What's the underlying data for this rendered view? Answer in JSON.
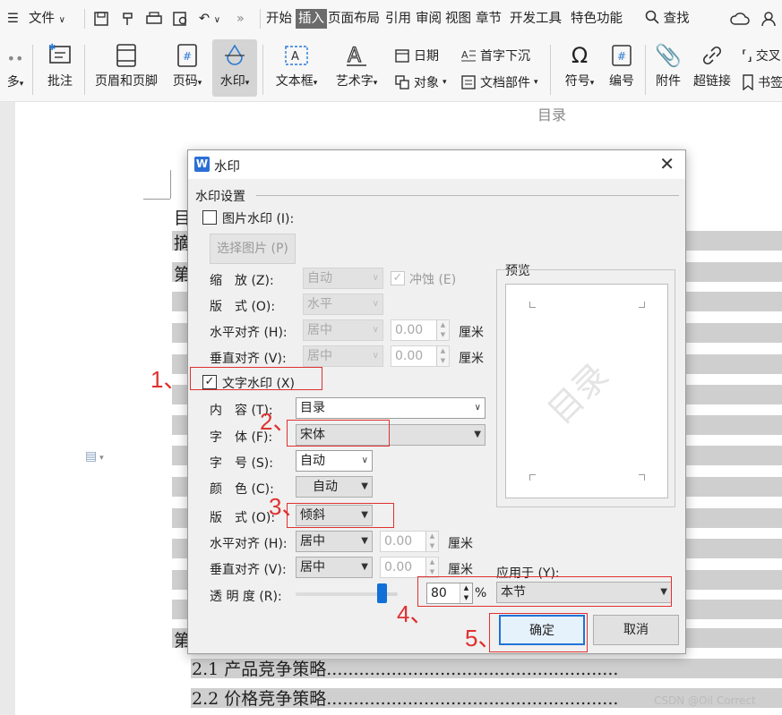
{
  "menubar": {
    "file_label": "文件",
    "tabs": [
      "开始",
      "插入",
      "页面布局",
      "引用",
      "审阅",
      "视图",
      "章节",
      "开发工具",
      "特色功能"
    ],
    "search_label": "查找"
  },
  "toolbar": {
    "more": "多",
    "comment": "批注",
    "header_footer": "页眉和页脚",
    "page_number": "页码",
    "watermark": "水印",
    "textbox": "文本框",
    "art_text": "艺术字",
    "date": "日期",
    "object": "对象",
    "drop_cap": "首字下沉",
    "doc_parts": "文档部件",
    "symbol": "符号",
    "numbering": "编号",
    "attachment": "附件",
    "hyperlink": "超链接",
    "cross_ref": "交叉",
    "bookmark": "书签"
  },
  "document": {
    "header_text": "目录",
    "line_mu": "目",
    "line_zhai": "摘",
    "line_di1": "第",
    "line_di2": "第",
    "toc_2_1": "2.1 产品竞争策略......................................................",
    "toc_2_2": "2.2 价格竞争策略......................................................",
    "watermark_credit": "CSDN @Oil Correct"
  },
  "dialog": {
    "title": "水印",
    "group_label": "水印设置",
    "picture_watermark": "图片水印 (I):",
    "select_picture": "选择图片 (P)",
    "scale_label": "缩　放 (Z):",
    "scale_value": "自动",
    "washout": "冲蚀 (E)",
    "layout_label_pic": "版　式 (O):",
    "layout_value_pic": "水平",
    "h_align_label_pic": "水平对齐 (H):",
    "h_align_value_pic": "居中",
    "h_offset_pic": "0.00",
    "v_align_label_pic": "垂直对齐 (V):",
    "v_align_value_pic": "居中",
    "v_offset_pic": "0.00",
    "unit_cm": "厘米",
    "text_watermark": "文字水印 (X)",
    "content_label": "内　容 (T):",
    "content_value": "目录",
    "font_label": "字　体 (F):",
    "font_value": "宋体",
    "size_label": "字　号 (S):",
    "size_value": "自动",
    "color_label": "颜　色 (C):",
    "color_value": "自动",
    "layout_label": "版　式 (O):",
    "layout_value": "倾斜",
    "h_align_label": "水平对齐 (H):",
    "h_align_value": "居中",
    "h_offset": "0.00",
    "v_align_label": "垂直对齐 (V):",
    "v_align_value": "居中",
    "v_offset": "0.00",
    "transparency_label": "透 明 度 (R):",
    "transparency_value": "80",
    "percent": "%",
    "preview_label": "预览",
    "preview_text": "目录",
    "apply_label": "应用于 (Y):",
    "apply_value": "本节",
    "ok": "确定",
    "cancel": "取消"
  },
  "annotations": [
    "1、",
    "2、",
    "3、",
    "4、",
    "5、"
  ],
  "transparency_fraction": 0.8
}
